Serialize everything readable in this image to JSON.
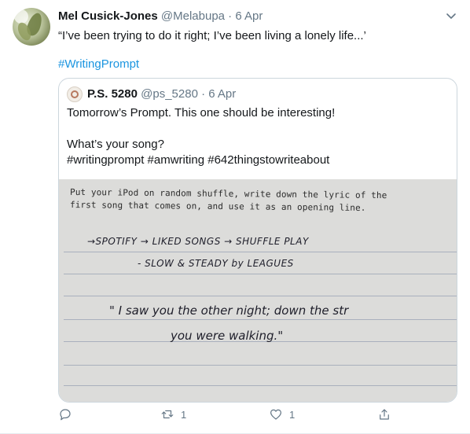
{
  "tweet": {
    "name": "Mel Cusick-Jones",
    "handle": "@Melabupa",
    "separator": "·",
    "date": "6 Apr",
    "text": "“I’ve been trying to do it right; I’ve been living a lonely life...’",
    "hashtag": "#WritingPrompt"
  },
  "quoted": {
    "name": "P.S. 5280",
    "handle": "@ps_5280",
    "separator": "·",
    "date": "6 Apr",
    "line1": "Tomorrow’s Prompt. This one should be interesting!",
    "line2": "What’s your song?",
    "line3": "#writingprompt #amwriting #642thingstowriteabout",
    "image": {
      "printed_line1": "Put your iPod on random shuffle, write down the lyric of the",
      "printed_line2": "first song that comes on, and use it as an opening line.",
      "hand_line1": "→SPOTIFY → LIKED  SONGS → SHUFFLE PLAY",
      "hand_line2": "- SLOW & STEADY  by LEAGUES",
      "hand_line3": "\" I    saw  you  the  other  night;  down the str",
      "hand_line4": "you  were  walking.\""
    }
  },
  "actions": {
    "reply_count": "",
    "retweet_count": "1",
    "like_count": "1"
  },
  "colors": {
    "link": "#1b95e0",
    "secondary": "#657786",
    "border": "#ccd6dd"
  },
  "icons": [
    "chevron-down-icon",
    "reply-icon",
    "retweet-icon",
    "like-icon",
    "share-icon"
  ]
}
